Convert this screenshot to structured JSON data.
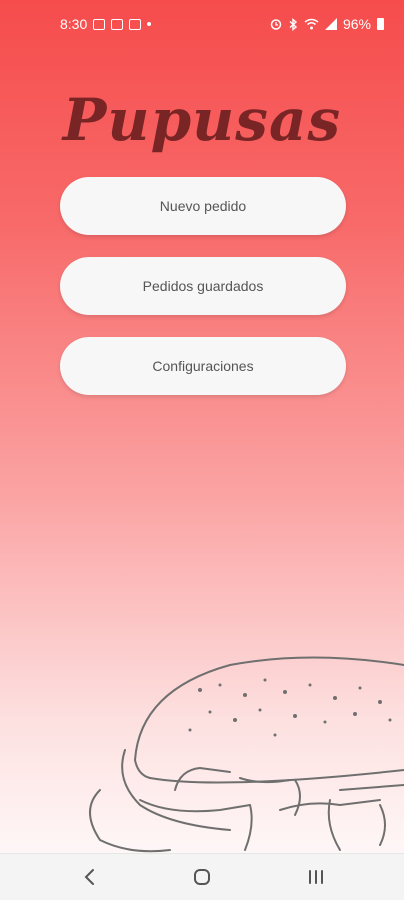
{
  "status_bar": {
    "time": "8:30",
    "battery_percent": "96%",
    "left_icons": [
      "notification-icon",
      "linkedin-icon",
      "message-icon",
      "dot-icon"
    ],
    "right_icons": [
      "alarm-icon",
      "bluetooth-icon",
      "wifi-icon",
      "signal-icon",
      "battery-icon"
    ]
  },
  "app": {
    "title": "Pupusas"
  },
  "menu": {
    "new_order": "Nuevo pedido",
    "saved_orders": "Pedidos guardados",
    "settings": "Configuraciones"
  },
  "nav": {
    "icons": [
      "back-icon",
      "home-icon",
      "recent-apps-icon"
    ]
  },
  "colors": {
    "gradient_top": "#f64c4c",
    "gradient_bottom": "#ffffff",
    "logo": "#7a2525",
    "button_bg": "#f7f7f7",
    "button_text": "#555555"
  }
}
